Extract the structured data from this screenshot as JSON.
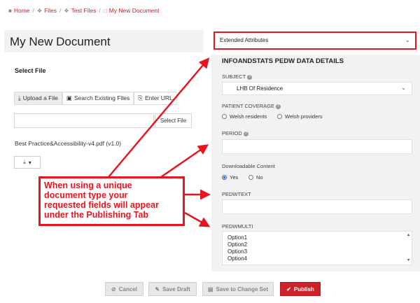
{
  "breadcrumb": [
    "Home",
    "Files",
    "Test Files",
    "My New Document"
  ],
  "page_title": "My New Document",
  "left": {
    "section_title": "Select File",
    "tabs": [
      "Upload a File",
      "Search Existing Files",
      "Enter URL"
    ],
    "select_button": "Select File",
    "file_name": "Best Practice&Accessibility-v4.pdf (v1.0)"
  },
  "right": {
    "dropdown_value": "Extended Attributes",
    "section_title": "INFOANDSTATS PEDW DATA DETAILS",
    "subject": {
      "label": "SUBJECT",
      "value": "LHB Of Residence"
    },
    "patient_coverage": {
      "label": "PATIENT COVERAGE",
      "options": [
        "Welsh residents",
        "Welsh providers"
      ]
    },
    "period": {
      "label": "PERIOD"
    },
    "downloadable": {
      "label": "Downloadable Content",
      "options": [
        "Yes",
        "No"
      ],
      "selected": "Yes"
    },
    "pedwtext": {
      "label": "PEDWTEXT"
    },
    "pedwmulti": {
      "label": "PEDWMULTI",
      "options": [
        "Option1",
        "Option2",
        "Option3",
        "Option4"
      ]
    }
  },
  "callout": {
    "lines": [
      "When using a unique",
      "document type your",
      "requested fields will appear",
      "under the Publishing Tab"
    ]
  },
  "actions": {
    "cancel": "Cancel",
    "save_draft": "Save Draft",
    "save_change_set": "Save to Change Set",
    "publish": "Publish"
  },
  "colors": {
    "accent": "#d0202a",
    "annotation": "#e8141e",
    "panel_bg": "#f2f2f2"
  }
}
